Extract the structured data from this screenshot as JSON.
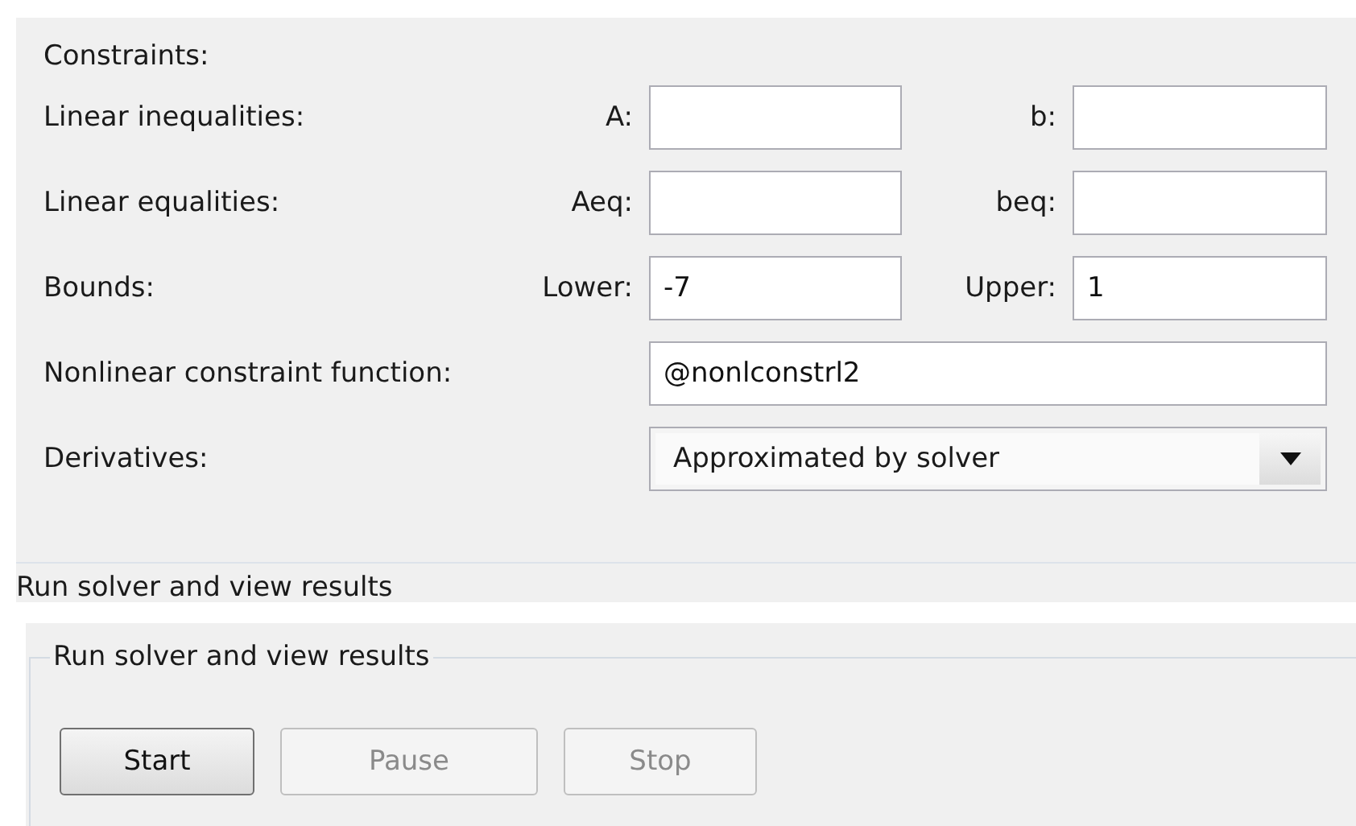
{
  "constraints": {
    "title": "Constraints:",
    "rows": [
      {
        "kind": "pair",
        "label": "Linear inequalities:",
        "fields": [
          {
            "label": "A:"
          },
          {
            "label": "b:"
          }
        ]
      },
      {
        "kind": "pair",
        "label": "Linear equalities:",
        "fields": [
          {
            "label": "Aeq:"
          },
          {
            "label": "beq:"
          }
        ]
      },
      {
        "kind": "pair",
        "label": "Bounds:",
        "fields": [
          {
            "label": "Lower:",
            "value": "-7"
          },
          {
            "label": "Upper:",
            "value": "1"
          }
        ]
      },
      {
        "kind": "wide",
        "label": "Nonlinear constraint function:",
        "value": "@nonlconstrl2"
      },
      {
        "kind": "dropdown",
        "label": "Derivatives:",
        "value": "Approximated by solver"
      }
    ]
  },
  "next_section_heading": "Run solver and view results",
  "run_panel": {
    "title": "Run solver and view results",
    "buttons": [
      {
        "label": "Start",
        "disabled": false
      },
      {
        "label": "Pause",
        "disabled": true
      },
      {
        "label": "Stop",
        "disabled": true
      }
    ]
  }
}
